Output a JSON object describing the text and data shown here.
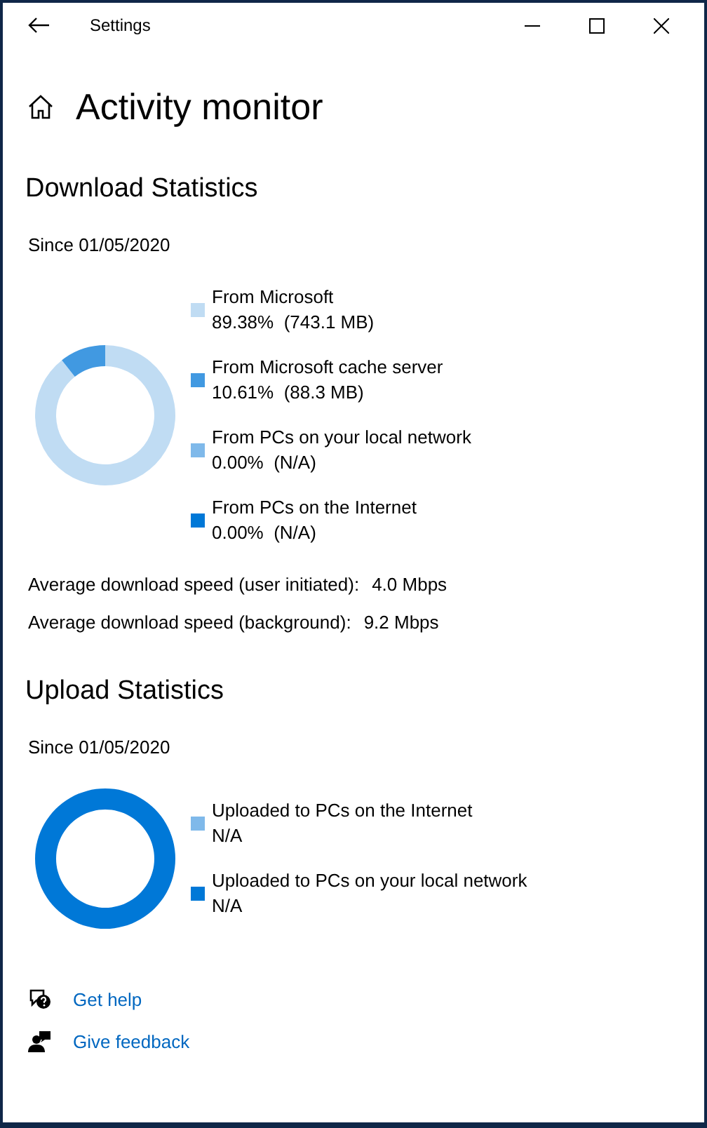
{
  "window": {
    "title": "Settings"
  },
  "page": {
    "title": "Activity monitor"
  },
  "download": {
    "heading": "Download Statistics",
    "since": "Since 01/05/2020",
    "chart_data": {
      "type": "donut",
      "values": [
        89.38,
        10.61,
        0,
        0
      ]
    },
    "legend": [
      {
        "label": "From Microsoft",
        "value": "89.38%  (743.1 MB)",
        "color": "#c0dcf3"
      },
      {
        "label": "From Microsoft cache server",
        "value": "10.61%  (88.3 MB)",
        "color": "#4199e1"
      },
      {
        "label": "From PCs on your local network",
        "value": "0.00%  (N/A)",
        "color": "#7fb9ea"
      },
      {
        "label": "From PCs on the Internet",
        "value": "0.00%  (N/A)",
        "color": "#0078d7"
      }
    ],
    "speeds": [
      {
        "label": "Average download speed (user initiated):",
        "value": "4.0 Mbps"
      },
      {
        "label": "Average download speed (background):",
        "value": "9.2 Mbps"
      }
    ]
  },
  "upload": {
    "heading": "Upload Statistics",
    "since": "Since 01/05/2020",
    "legend": [
      {
        "label": "Uploaded to PCs on the Internet",
        "value": "N/A",
        "color": "#7fb9ea"
      },
      {
        "label": "Uploaded to PCs on your local network",
        "value": "N/A",
        "color": "#0078d7"
      }
    ]
  },
  "links": [
    {
      "kind": "help",
      "label": "Get help"
    },
    {
      "kind": "feedback",
      "label": "Give feedback"
    }
  ]
}
